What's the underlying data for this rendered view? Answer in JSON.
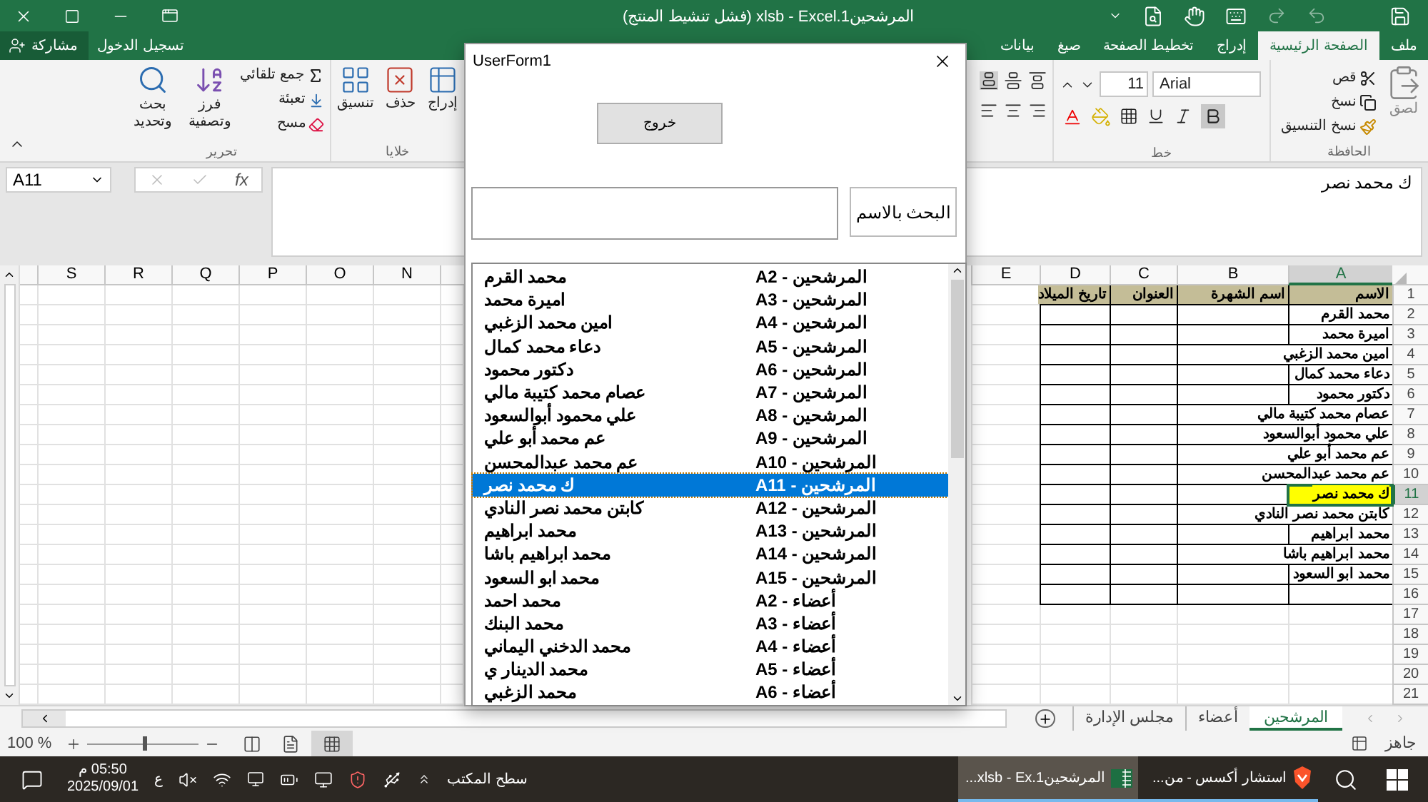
{
  "window": {
    "title": "المرشحين1.xlsb - Excel (فشل تنشيط المنتج)"
  },
  "account": {
    "sign_in": "تسجيل الدخول",
    "share": "مشاركة"
  },
  "ribbon_tabs": [
    {
      "label": "ملف",
      "selected": false
    },
    {
      "label": "الصفحة الرئيسية",
      "selected": true
    },
    {
      "label": "إدراج",
      "selected": false
    },
    {
      "label": "تخطيط الصفحة",
      "selected": false
    },
    {
      "label": "صيغ",
      "selected": false
    },
    {
      "label": "بيانات",
      "selected": false
    }
  ],
  "ribbon": {
    "clipboard": {
      "label": "الحافظة",
      "paste": "لصق",
      "cut": "قص",
      "copy": "نسخ",
      "format_painter": "نسخ التنسيق"
    },
    "font": {
      "label": "خط",
      "name": "Arial",
      "size": "11",
      "bold": true
    },
    "cells": {
      "label": "خلايا",
      "insert": "إدراج",
      "delete": "حذف",
      "format": "تنسيق"
    },
    "editing": {
      "label": "تحرير",
      "autosum": "جمع تلقائي",
      "fill": "تعبئة",
      "clear": "مسح",
      "sort_filter": [
        "فرز",
        "وتصفية"
      ],
      "find_select": [
        "بحث",
        "وتحديد"
      ]
    }
  },
  "formula_bar": {
    "name_box": "A11",
    "function_button": "fx",
    "value": "ك محمد نصر"
  },
  "sheet": {
    "right_columns": [
      "A",
      "B",
      "C",
      "D",
      "E"
    ],
    "left_columns": [
      "N",
      "O",
      "P",
      "Q",
      "R",
      "S"
    ],
    "rows": [
      {
        "number": "1",
        "kind": "header",
        "selected": false,
        "highlighted": false,
        "cells": [
          "الاسم",
          "اسم الشهرة",
          "العنوان",
          "تاريخ الميلاد"
        ]
      },
      {
        "number": "2",
        "kind": "data",
        "selected": false,
        "highlighted": false,
        "cells": [
          "محمد القرم"
        ]
      },
      {
        "number": "3",
        "kind": "data",
        "selected": false,
        "highlighted": false,
        "cells": [
          "اميرة محمد"
        ]
      },
      {
        "number": "4",
        "kind": "data",
        "selected": false,
        "highlighted": false,
        "cells": [
          "امين محمد الزغبي"
        ]
      },
      {
        "number": "5",
        "kind": "data",
        "selected": false,
        "highlighted": false,
        "cells": [
          "دعاء محمد كمال"
        ]
      },
      {
        "number": "6",
        "kind": "data",
        "selected": false,
        "highlighted": false,
        "cells": [
          "دكتور محمود"
        ]
      },
      {
        "number": "7",
        "kind": "data",
        "selected": false,
        "highlighted": false,
        "cells": [
          "عصام محمد كتيبة مالي"
        ]
      },
      {
        "number": "8",
        "kind": "data",
        "selected": false,
        "highlighted": false,
        "cells": [
          "علي محمود أبوالسعود"
        ]
      },
      {
        "number": "9",
        "kind": "data",
        "selected": false,
        "highlighted": false,
        "cells": [
          "عم محمد أبو علي"
        ]
      },
      {
        "number": "10",
        "kind": "data",
        "selected": false,
        "highlighted": false,
        "cells": [
          "عم محمد عبدالمحسن"
        ]
      },
      {
        "number": "11",
        "kind": "data",
        "selected": true,
        "highlighted": true,
        "cells": [
          "ك محمد نصر"
        ]
      },
      {
        "number": "12",
        "kind": "data",
        "selected": false,
        "highlighted": false,
        "cells": [
          "كابتن محمد نصر النادي"
        ]
      },
      {
        "number": "13",
        "kind": "data",
        "selected": false,
        "highlighted": false,
        "cells": [
          "محمد ابراهيم"
        ]
      },
      {
        "number": "14",
        "kind": "data",
        "selected": false,
        "highlighted": false,
        "cells": [
          "محمد ابراهيم باشا"
        ]
      },
      {
        "number": "15",
        "kind": "data",
        "selected": false,
        "highlighted": false,
        "cells": [
          "محمد ابو السعود"
        ]
      },
      {
        "number": "16",
        "kind": "data",
        "selected": false,
        "highlighted": false
      },
      {
        "number": "17",
        "kind": "empty",
        "selected": false,
        "highlighted": false
      },
      {
        "number": "18",
        "kind": "empty",
        "selected": false,
        "highlighted": false
      },
      {
        "number": "19",
        "kind": "empty",
        "selected": false,
        "highlighted": false
      },
      {
        "number": "20",
        "kind": "empty",
        "selected": false,
        "highlighted": false
      },
      {
        "number": "21",
        "kind": "empty",
        "selected": false,
        "highlighted": false
      }
    ]
  },
  "sheet_tabs": [
    {
      "label": "المرشحين",
      "selected": true
    },
    {
      "label": "أعضاء",
      "selected": false
    },
    {
      "label": "مجلس الإدارة",
      "selected": false
    }
  ],
  "status_bar": {
    "status": "جاهز",
    "zoom": "100 %",
    "zoom_slider": {
      "level": 0.5
    }
  },
  "userform": {
    "title": "UserForm1",
    "exit_button": "خروج",
    "search_label": "البحث بالاسم",
    "list": [
      {
        "name": "محمد القرم",
        "location": "المرشحين - A2",
        "selected": false
      },
      {
        "name": "اميرة محمد",
        "location": "المرشحين - A3",
        "selected": false
      },
      {
        "name": "امين محمد الزغبي",
        "location": "المرشحين - A4",
        "selected": false
      },
      {
        "name": "دعاء محمد كمال",
        "location": "المرشحين - A5",
        "selected": false
      },
      {
        "name": "دكتور محمود",
        "location": "المرشحين - A6",
        "selected": false
      },
      {
        "name": "عصام محمد كتيبة مالي",
        "location": "المرشحين - A7",
        "selected": false
      },
      {
        "name": "علي محمود أبوالسعود",
        "location": "المرشحين - A8",
        "selected": false
      },
      {
        "name": "عم محمد أبو علي",
        "location": "المرشحين - A9",
        "selected": false
      },
      {
        "name": "عم محمد عبدالمحسن",
        "location": "المرشحين - A10",
        "selected": false
      },
      {
        "name": "ك محمد نصر",
        "location": "المرشحين - A11",
        "selected": true
      },
      {
        "name": "كابتن محمد نصر النادي",
        "location": "المرشحين - A12",
        "selected": false
      },
      {
        "name": "محمد ابراهيم",
        "location": "المرشحين - A13",
        "selected": false
      },
      {
        "name": "محمد ابراهيم باشا",
        "location": "المرشحين - A14",
        "selected": false
      },
      {
        "name": "محمد ابو السعود",
        "location": "المرشحين - A15",
        "selected": false
      },
      {
        "name": "محمد احمد",
        "location": "أعضاء - A2",
        "selected": false
      },
      {
        "name": "محمد البنك",
        "location": "أعضاء - A3",
        "selected": false
      },
      {
        "name": "محمد الدخني اليماني",
        "location": "أعضاء - A4",
        "selected": false
      },
      {
        "name": "محمد الدينار ي",
        "location": "أعضاء - A5",
        "selected": false
      },
      {
        "name": "محمد الزغبي",
        "location": "أعضاء - A6",
        "selected": false
      }
    ]
  },
  "taskbar": {
    "apps": [
      {
        "label": "استشار أكسس - من...",
        "kind": "browser",
        "selected": false
      },
      {
        "label": "المرشحين1.xlsb - Ex...",
        "kind": "excel",
        "selected": true
      }
    ],
    "desktop": "سطح المكتب",
    "language": "ع",
    "time": "05:50 م",
    "date": "2025/09/01"
  }
}
